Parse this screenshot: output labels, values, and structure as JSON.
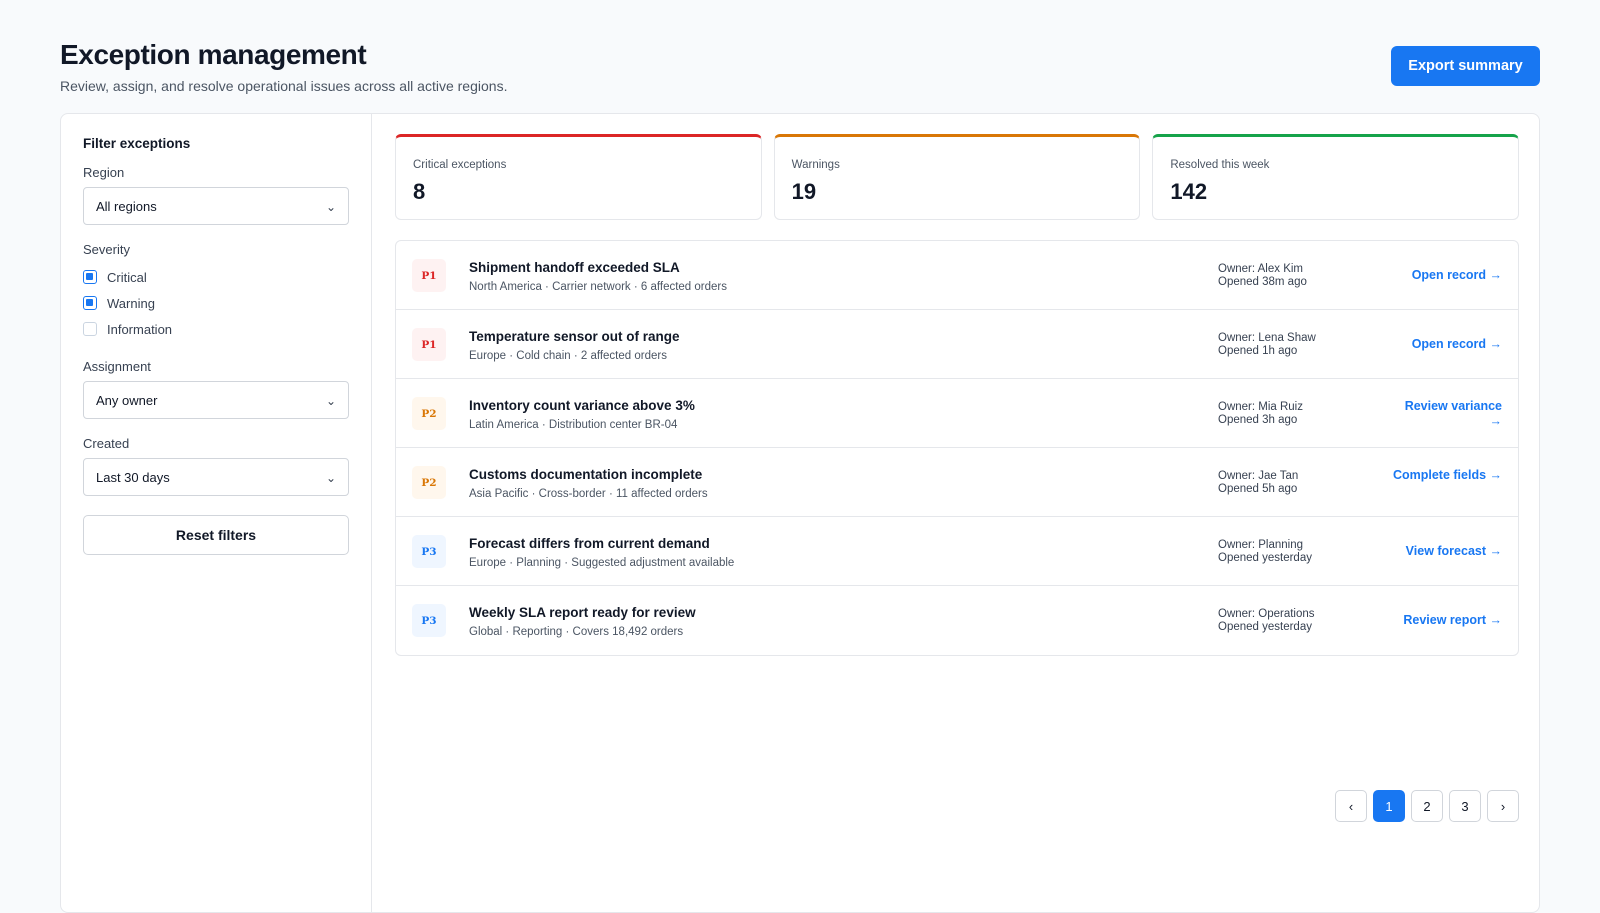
{
  "header": {
    "title": "Exception management",
    "subtitle": "Review, assign, and resolve operational issues across all active regions.",
    "export_label": "Export summary"
  },
  "filters": {
    "title": "Filter exceptions",
    "region": {
      "label": "Region",
      "value": "All regions"
    },
    "severity": {
      "label": "Severity",
      "options": [
        {
          "label": "Critical",
          "checked": true
        },
        {
          "label": "Warning",
          "checked": true
        },
        {
          "label": "Information",
          "checked": false
        }
      ]
    },
    "assignment": {
      "label": "Assignment",
      "value": "Any owner"
    },
    "created": {
      "label": "Created",
      "value": "Last 30 days"
    },
    "reset_label": "Reset filters"
  },
  "stats": [
    {
      "label": "Critical exceptions",
      "value": "8",
      "color": "#dc2626"
    },
    {
      "label": "Warnings",
      "value": "19",
      "color": "#d97706"
    },
    {
      "label": "Resolved this week",
      "value": "142",
      "color": "#16a34a"
    }
  ],
  "exceptions": [
    {
      "priority": "P1",
      "title": "Shipment handoff exceeded SLA",
      "meta": "North America · Carrier network · 6 affected orders",
      "owner": "Owner: Alex Kim",
      "opened": "Opened 38m ago",
      "action": "Open record →"
    },
    {
      "priority": "P1",
      "title": "Temperature sensor out of range",
      "meta": "Europe · Cold chain · 2 affected orders",
      "owner": "Owner: Lena Shaw",
      "opened": "Opened 1h ago",
      "action": "Open record →"
    },
    {
      "priority": "P2",
      "title": "Inventory count variance above 3%",
      "meta": "Latin America · Distribution center BR-04",
      "owner": "Owner: Mia Ruiz",
      "opened": "Opened 3h ago",
      "action": "Review variance →"
    },
    {
      "priority": "P2",
      "title": "Customs documentation incomplete",
      "meta": "Asia Pacific · Cross-border · 11 affected orders",
      "owner": "Owner: Jae Tan",
      "opened": "Opened 5h ago",
      "action": "Complete fields →"
    },
    {
      "priority": "P3",
      "title": "Forecast differs from current demand",
      "meta": "Europe · Planning · Suggested adjustment available",
      "owner": "Owner: Planning",
      "opened": "Opened yesterday",
      "action": "View forecast →"
    },
    {
      "priority": "P3",
      "title": "Weekly SLA report ready for review",
      "meta": "Global · Reporting · Covers 18,492 orders",
      "owner": "Owner: Operations",
      "opened": "Opened yesterday",
      "action": "Review report →"
    }
  ],
  "pagination": {
    "prev": "‹",
    "pages": [
      "1",
      "2",
      "3"
    ],
    "active": "1",
    "next": "›"
  },
  "icons": {
    "chevron": "chevron-down-icon"
  }
}
